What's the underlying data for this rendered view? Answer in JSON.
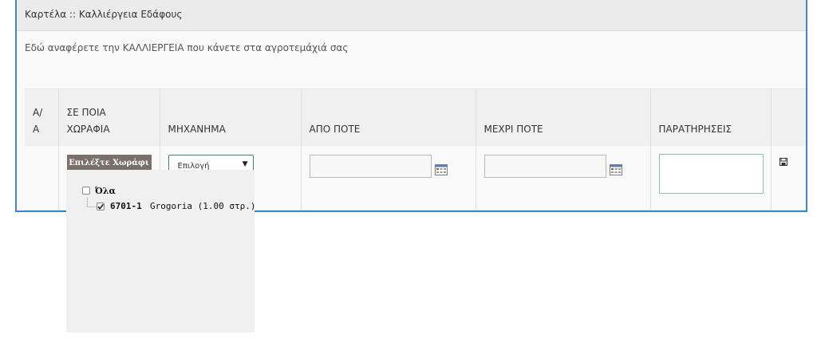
{
  "panel": {
    "title": "Καρτέλα :: Καλλιέργεια Εδάφους",
    "intro": "Εδώ αναφέρετε την ΚΑΛΛΙΕΡΓΕΙΑ που κάνετε στα αγροτεμάχιά σας"
  },
  "table": {
    "headers": {
      "aa_line1": "Α/",
      "aa_line2": "Α",
      "field_line1": "ΣΕ ΠΟΙΑ",
      "field_line2": "ΧΩΡΑΦΙΑ",
      "machine": "ΜΗΧΑΝΗΜΑ",
      "from": "ΑΠΟ ΠΟΤΕ",
      "until": "ΜΕΧΡΙ ΠΟΤΕ",
      "notes": "ΠΑΡΑΤΗΡΗΣΕΙΣ"
    },
    "row": {
      "choose_field_button": "Επιλέξτε Χωράφι",
      "machine_select_value": "Επιλογή",
      "from_value": "",
      "until_value": "",
      "notes_value": ""
    }
  },
  "dropdown": {
    "all_label": "Όλα",
    "all_checked": false,
    "items": [
      {
        "code": "6701-1",
        "name": "Grogoria (1.00 στρ.)",
        "checked": true
      }
    ]
  },
  "icons": {
    "calendar": "calendar-icon",
    "save": "save-icon",
    "select_arrow": "▼"
  },
  "colors": {
    "panel_border": "#3b87c8",
    "button_bg": "#7a6f6a",
    "select_border": "#3a8a6a",
    "notes_border": "#8fc4a8"
  }
}
